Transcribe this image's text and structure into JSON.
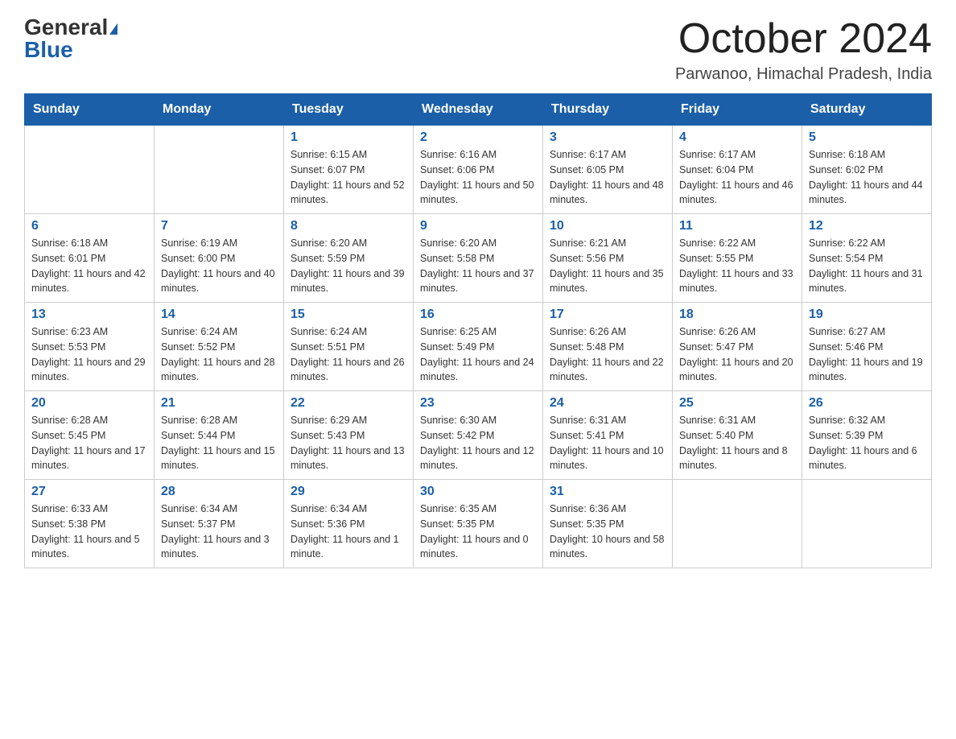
{
  "header": {
    "logo_line1": "General",
    "logo_line2": "Blue",
    "month_title": "October 2024",
    "location": "Parwanoo, Himachal Pradesh, India"
  },
  "days_of_week": [
    "Sunday",
    "Monday",
    "Tuesday",
    "Wednesday",
    "Thursday",
    "Friday",
    "Saturday"
  ],
  "weeks": [
    [
      {
        "day": "",
        "sunrise": "",
        "sunset": "",
        "daylight": ""
      },
      {
        "day": "",
        "sunrise": "",
        "sunset": "",
        "daylight": ""
      },
      {
        "day": "1",
        "sunrise": "Sunrise: 6:15 AM",
        "sunset": "Sunset: 6:07 PM",
        "daylight": "Daylight: 11 hours and 52 minutes."
      },
      {
        "day": "2",
        "sunrise": "Sunrise: 6:16 AM",
        "sunset": "Sunset: 6:06 PM",
        "daylight": "Daylight: 11 hours and 50 minutes."
      },
      {
        "day": "3",
        "sunrise": "Sunrise: 6:17 AM",
        "sunset": "Sunset: 6:05 PM",
        "daylight": "Daylight: 11 hours and 48 minutes."
      },
      {
        "day": "4",
        "sunrise": "Sunrise: 6:17 AM",
        "sunset": "Sunset: 6:04 PM",
        "daylight": "Daylight: 11 hours and 46 minutes."
      },
      {
        "day": "5",
        "sunrise": "Sunrise: 6:18 AM",
        "sunset": "Sunset: 6:02 PM",
        "daylight": "Daylight: 11 hours and 44 minutes."
      }
    ],
    [
      {
        "day": "6",
        "sunrise": "Sunrise: 6:18 AM",
        "sunset": "Sunset: 6:01 PM",
        "daylight": "Daylight: 11 hours and 42 minutes."
      },
      {
        "day": "7",
        "sunrise": "Sunrise: 6:19 AM",
        "sunset": "Sunset: 6:00 PM",
        "daylight": "Daylight: 11 hours and 40 minutes."
      },
      {
        "day": "8",
        "sunrise": "Sunrise: 6:20 AM",
        "sunset": "Sunset: 5:59 PM",
        "daylight": "Daylight: 11 hours and 39 minutes."
      },
      {
        "day": "9",
        "sunrise": "Sunrise: 6:20 AM",
        "sunset": "Sunset: 5:58 PM",
        "daylight": "Daylight: 11 hours and 37 minutes."
      },
      {
        "day": "10",
        "sunrise": "Sunrise: 6:21 AM",
        "sunset": "Sunset: 5:56 PM",
        "daylight": "Daylight: 11 hours and 35 minutes."
      },
      {
        "day": "11",
        "sunrise": "Sunrise: 6:22 AM",
        "sunset": "Sunset: 5:55 PM",
        "daylight": "Daylight: 11 hours and 33 minutes."
      },
      {
        "day": "12",
        "sunrise": "Sunrise: 6:22 AM",
        "sunset": "Sunset: 5:54 PM",
        "daylight": "Daylight: 11 hours and 31 minutes."
      }
    ],
    [
      {
        "day": "13",
        "sunrise": "Sunrise: 6:23 AM",
        "sunset": "Sunset: 5:53 PM",
        "daylight": "Daylight: 11 hours and 29 minutes."
      },
      {
        "day": "14",
        "sunrise": "Sunrise: 6:24 AM",
        "sunset": "Sunset: 5:52 PM",
        "daylight": "Daylight: 11 hours and 28 minutes."
      },
      {
        "day": "15",
        "sunrise": "Sunrise: 6:24 AM",
        "sunset": "Sunset: 5:51 PM",
        "daylight": "Daylight: 11 hours and 26 minutes."
      },
      {
        "day": "16",
        "sunrise": "Sunrise: 6:25 AM",
        "sunset": "Sunset: 5:49 PM",
        "daylight": "Daylight: 11 hours and 24 minutes."
      },
      {
        "day": "17",
        "sunrise": "Sunrise: 6:26 AM",
        "sunset": "Sunset: 5:48 PM",
        "daylight": "Daylight: 11 hours and 22 minutes."
      },
      {
        "day": "18",
        "sunrise": "Sunrise: 6:26 AM",
        "sunset": "Sunset: 5:47 PM",
        "daylight": "Daylight: 11 hours and 20 minutes."
      },
      {
        "day": "19",
        "sunrise": "Sunrise: 6:27 AM",
        "sunset": "Sunset: 5:46 PM",
        "daylight": "Daylight: 11 hours and 19 minutes."
      }
    ],
    [
      {
        "day": "20",
        "sunrise": "Sunrise: 6:28 AM",
        "sunset": "Sunset: 5:45 PM",
        "daylight": "Daylight: 11 hours and 17 minutes."
      },
      {
        "day": "21",
        "sunrise": "Sunrise: 6:28 AM",
        "sunset": "Sunset: 5:44 PM",
        "daylight": "Daylight: 11 hours and 15 minutes."
      },
      {
        "day": "22",
        "sunrise": "Sunrise: 6:29 AM",
        "sunset": "Sunset: 5:43 PM",
        "daylight": "Daylight: 11 hours and 13 minutes."
      },
      {
        "day": "23",
        "sunrise": "Sunrise: 6:30 AM",
        "sunset": "Sunset: 5:42 PM",
        "daylight": "Daylight: 11 hours and 12 minutes."
      },
      {
        "day": "24",
        "sunrise": "Sunrise: 6:31 AM",
        "sunset": "Sunset: 5:41 PM",
        "daylight": "Daylight: 11 hours and 10 minutes."
      },
      {
        "day": "25",
        "sunrise": "Sunrise: 6:31 AM",
        "sunset": "Sunset: 5:40 PM",
        "daylight": "Daylight: 11 hours and 8 minutes."
      },
      {
        "day": "26",
        "sunrise": "Sunrise: 6:32 AM",
        "sunset": "Sunset: 5:39 PM",
        "daylight": "Daylight: 11 hours and 6 minutes."
      }
    ],
    [
      {
        "day": "27",
        "sunrise": "Sunrise: 6:33 AM",
        "sunset": "Sunset: 5:38 PM",
        "daylight": "Daylight: 11 hours and 5 minutes."
      },
      {
        "day": "28",
        "sunrise": "Sunrise: 6:34 AM",
        "sunset": "Sunset: 5:37 PM",
        "daylight": "Daylight: 11 hours and 3 minutes."
      },
      {
        "day": "29",
        "sunrise": "Sunrise: 6:34 AM",
        "sunset": "Sunset: 5:36 PM",
        "daylight": "Daylight: 11 hours and 1 minute."
      },
      {
        "day": "30",
        "sunrise": "Sunrise: 6:35 AM",
        "sunset": "Sunset: 5:35 PM",
        "daylight": "Daylight: 11 hours and 0 minutes."
      },
      {
        "day": "31",
        "sunrise": "Sunrise: 6:36 AM",
        "sunset": "Sunset: 5:35 PM",
        "daylight": "Daylight: 10 hours and 58 minutes."
      },
      {
        "day": "",
        "sunrise": "",
        "sunset": "",
        "daylight": ""
      },
      {
        "day": "",
        "sunrise": "",
        "sunset": "",
        "daylight": ""
      }
    ]
  ]
}
